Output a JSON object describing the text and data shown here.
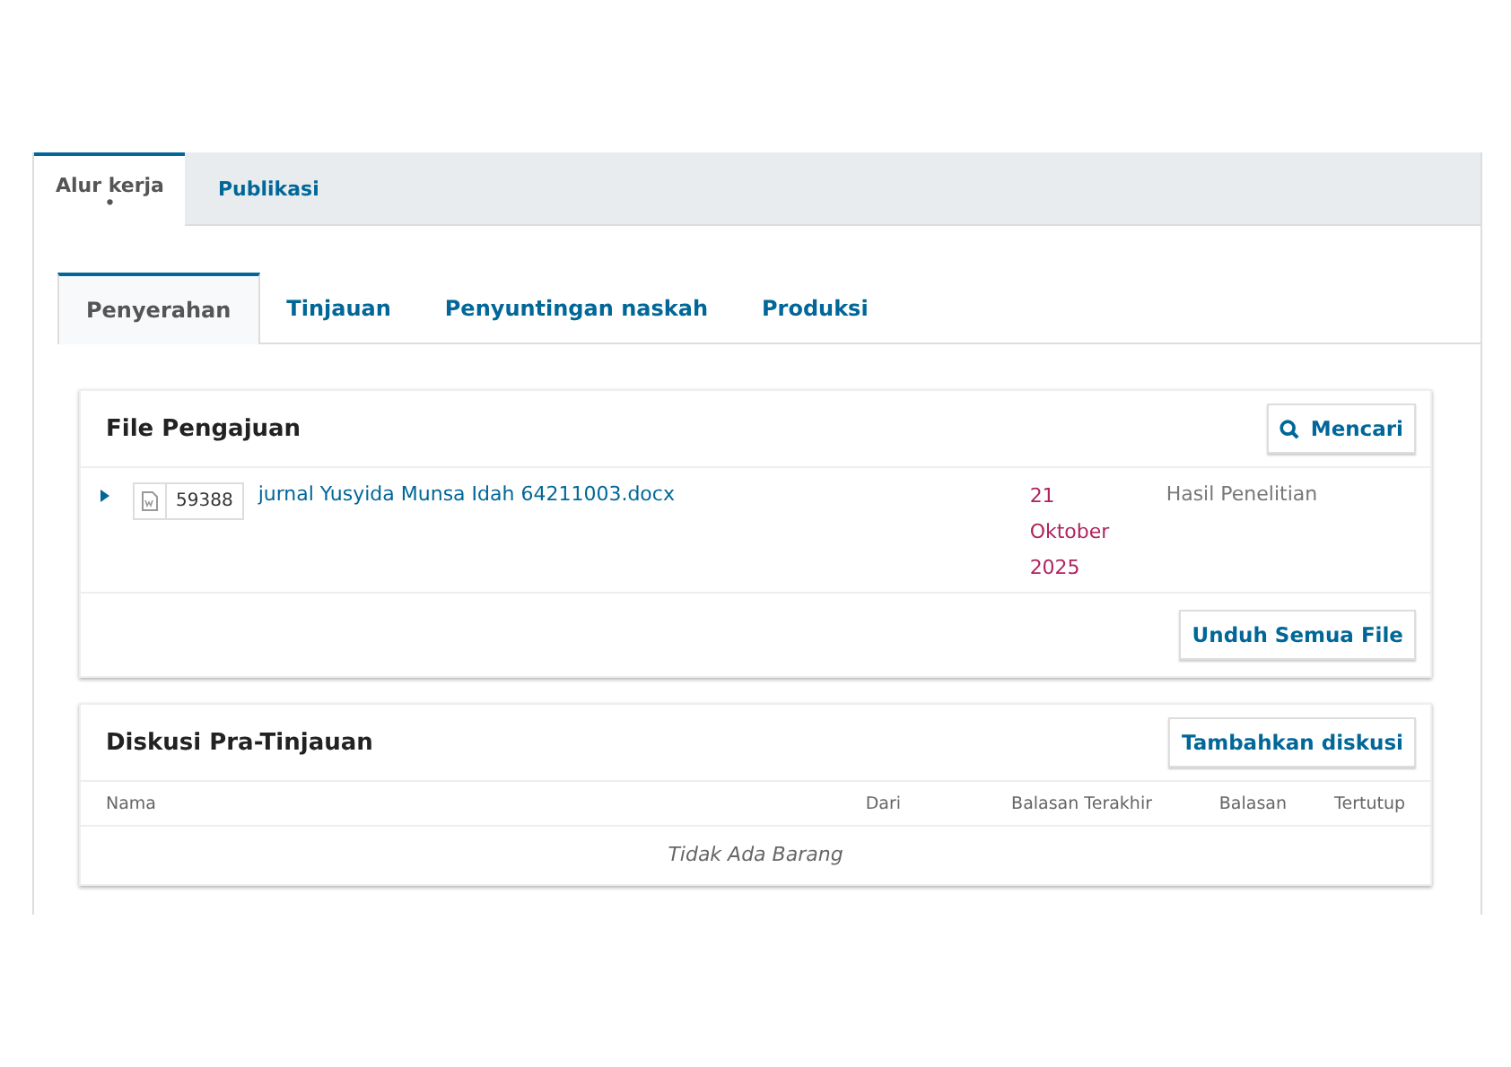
{
  "top_tabs": [
    {
      "label": "Alur kerja",
      "selected": true,
      "badge": "•"
    },
    {
      "label": "Publikasi",
      "selected": false
    }
  ],
  "stage_tabs": [
    {
      "label": "Penyerahan",
      "selected": true
    },
    {
      "label": "Tinjauan",
      "selected": false
    },
    {
      "label": "Penyuntingan naskah",
      "selected": false
    },
    {
      "label": "Produksi",
      "selected": false
    }
  ],
  "files_panel": {
    "title": "File Pengajuan",
    "search_button": "Mencari",
    "files": [
      {
        "expanded": false,
        "id": "59388",
        "name": "jurnal Yusyida Munsa Idah 64211003.docx",
        "date": "21 Oktober 2025",
        "type": "Hasil Penelitian"
      }
    ],
    "download_button": "Unduh Semua File"
  },
  "discussions_panel": {
    "title": "Diskusi Pra-Tinjauan",
    "add_button": "Tambahkan diskusi",
    "columns": [
      "Nama",
      "Dari",
      "Balasan Terakhir",
      "Balasan",
      "Tertutup"
    ],
    "empty": "Tidak Ada Barang"
  }
}
